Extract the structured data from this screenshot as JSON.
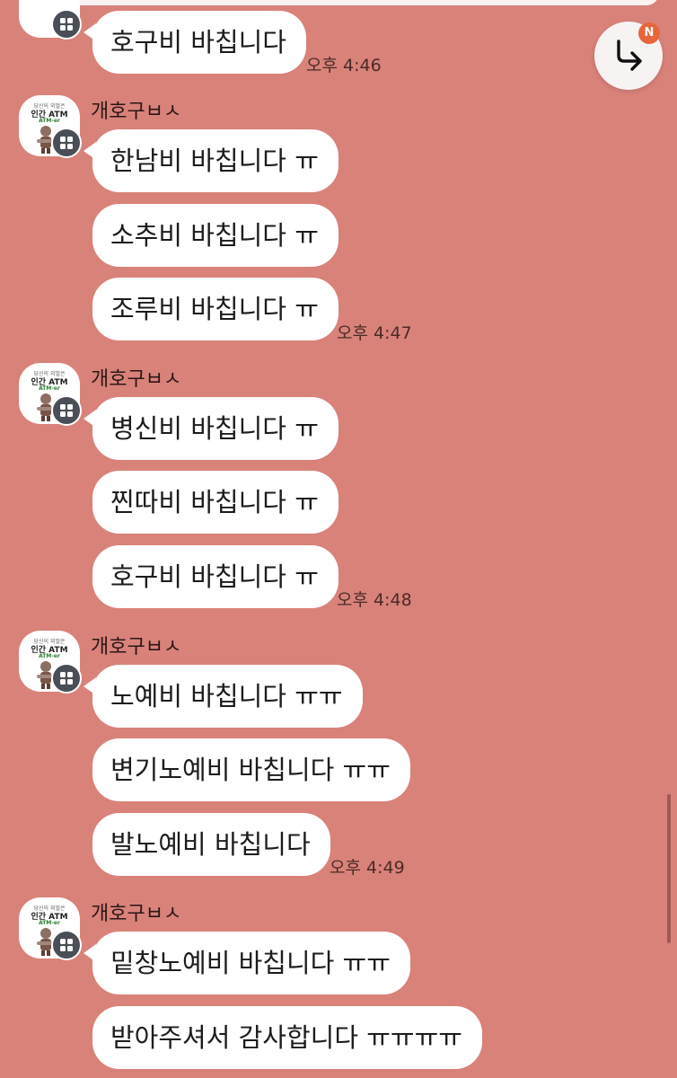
{
  "theme": {
    "background": "#d9827a",
    "bubble": "#ffffff",
    "badge_color": "#e8663c"
  },
  "jump_button": {
    "icon": "arrow-turn-down-right-icon",
    "badge": "N"
  },
  "avatar_caption": {
    "line1": "당신의 외벌은",
    "line2": "인간 ATM",
    "line3": "ATM-er"
  },
  "messages": [
    {
      "text": "호구비 바칩니다",
      "time": "오후 4:46"
    },
    {
      "sender": "개호구ㅂㅅ",
      "text": "한남비 바칩니다 ㅠ"
    },
    {
      "text": "소추비 바칩니다 ㅠ"
    },
    {
      "text": "조루비 바칩니다 ㅠ",
      "time": "오후 4:47"
    },
    {
      "sender": "개호구ㅂㅅ",
      "text": "병신비 바칩니다 ㅠ"
    },
    {
      "text": "찐따비 바칩니다 ㅠ"
    },
    {
      "text": "호구비 바칩니다 ㅠ",
      "time": "오후 4:48"
    },
    {
      "sender": "개호구ㅂㅅ",
      "text": "노예비 바칩니다 ㅠㅠ"
    },
    {
      "text": "변기노예비 바칩니다 ㅠㅠ"
    },
    {
      "text": "발노예비 바칩니다",
      "time": "오후 4:49"
    },
    {
      "sender": "개호구ㅂㅅ",
      "text": "밑창노예비 바칩니다 ㅠㅠ"
    },
    {
      "text": "받아주셔서 감사합니다 ㅠㅠㅠㅠ"
    }
  ]
}
